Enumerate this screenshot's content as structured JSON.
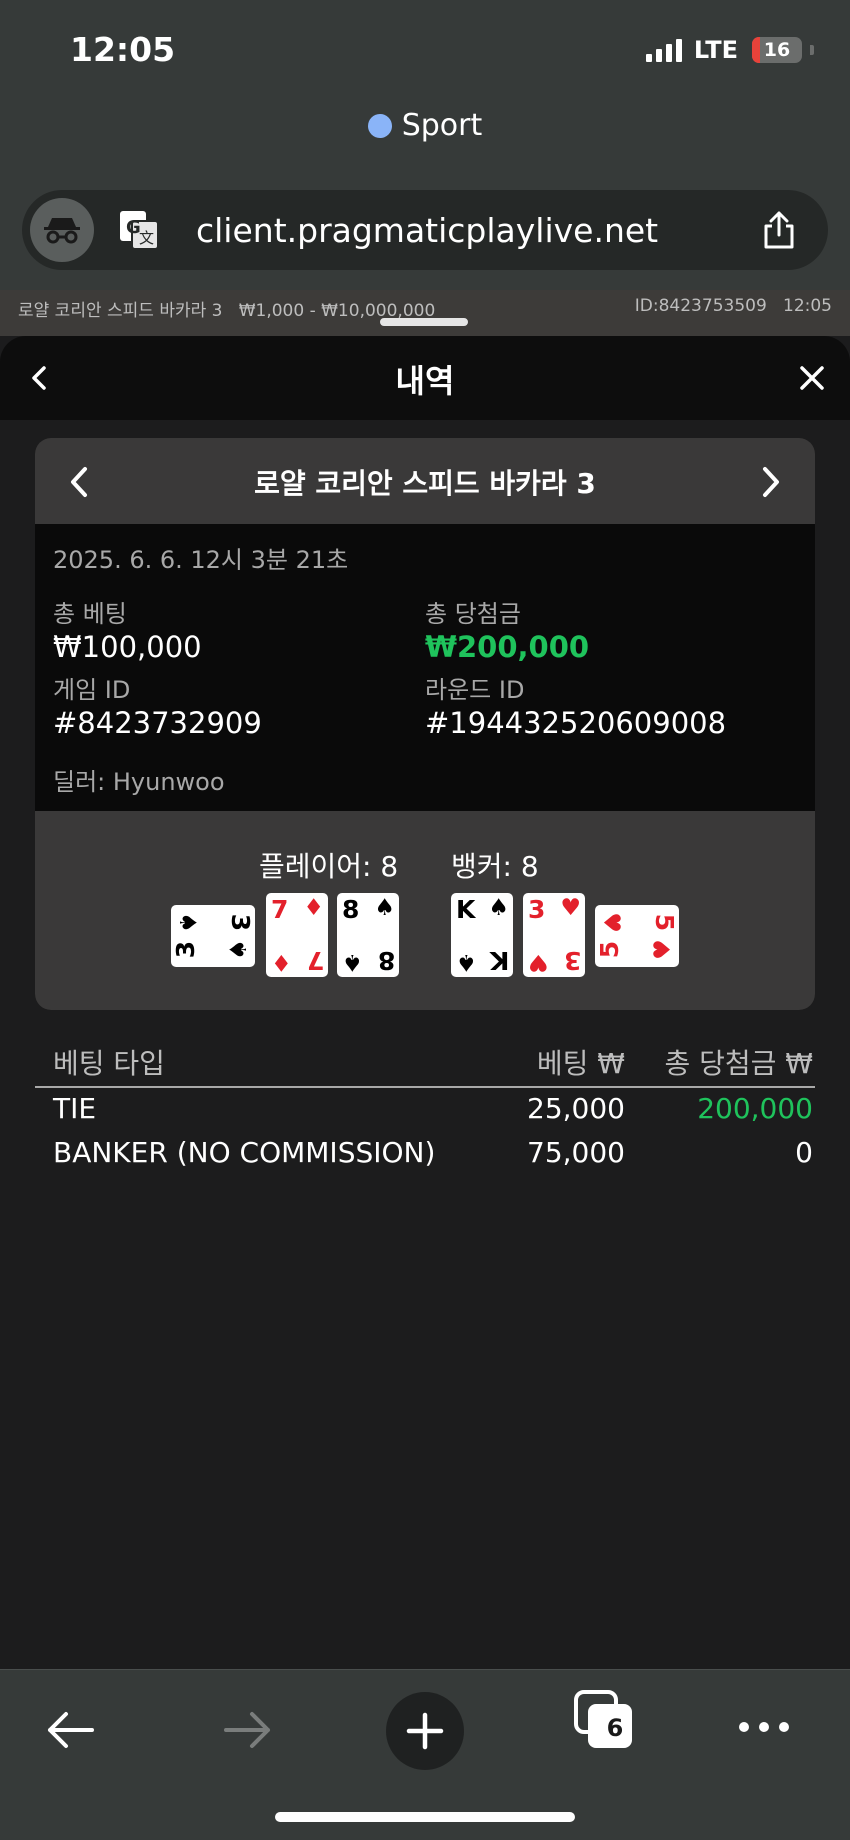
{
  "status_bar": {
    "time": "12:05",
    "network": "LTE",
    "battery": "16"
  },
  "browser": {
    "tab_title": "Sport",
    "url": "client.pragmaticplaylive.net",
    "tab_count": "6"
  },
  "game_strip": {
    "table_name": "로얄 코리안 스피드 바카라 3",
    "limits": "₩1,000 - ₩10,000,000",
    "id": "ID:8423753509",
    "time": "12:05"
  },
  "history": {
    "title": "내역",
    "nav_title": "로얄 코리안 스피드 바카라 3",
    "timestamp": "2025. 6. 6. 12시 3분 21초",
    "total_bet_label": "총 베팅",
    "total_bet_value": "₩100,000",
    "total_win_label": "총 당첨금",
    "total_win_value": "₩200,000",
    "game_id_label": "게임 ID",
    "game_id_value": "#8423732909",
    "round_id_label": "라운드 ID",
    "round_id_value": "#194432520609008",
    "dealer": "딜러: Hyunwoo",
    "player_score": "플레이어: 8",
    "banker_score": "뱅커: 8",
    "player_cards": [
      {
        "rank": "3",
        "suit": "♠",
        "color": "#000000",
        "rotated": true
      },
      {
        "rank": "7",
        "suit": "♦",
        "color": "#e3202b",
        "rotated": false
      },
      {
        "rank": "8",
        "suit": "♠",
        "color": "#000000",
        "rotated": false
      }
    ],
    "banker_cards": [
      {
        "rank": "K",
        "suit": "♠",
        "color": "#000000",
        "rotated": false
      },
      {
        "rank": "3",
        "suit": "♥",
        "color": "#e3202b",
        "rotated": false
      },
      {
        "rank": "5",
        "suit": "♥",
        "color": "#e3202b",
        "rotated": true
      }
    ]
  },
  "bets_table": {
    "headers": [
      "베팅 타입",
      "베팅 ₩",
      "총 당첨금 ₩"
    ],
    "rows": [
      {
        "type": "TIE",
        "bet": "25,000",
        "win": "200,000"
      },
      {
        "type": "BANKER (NO COMMISSION)",
        "bet": "75,000",
        "win": "0"
      }
    ]
  },
  "colors": {
    "win_green": "#1fc35c",
    "card_red": "#e3202b",
    "accent_blue": "#8ab4f8"
  }
}
